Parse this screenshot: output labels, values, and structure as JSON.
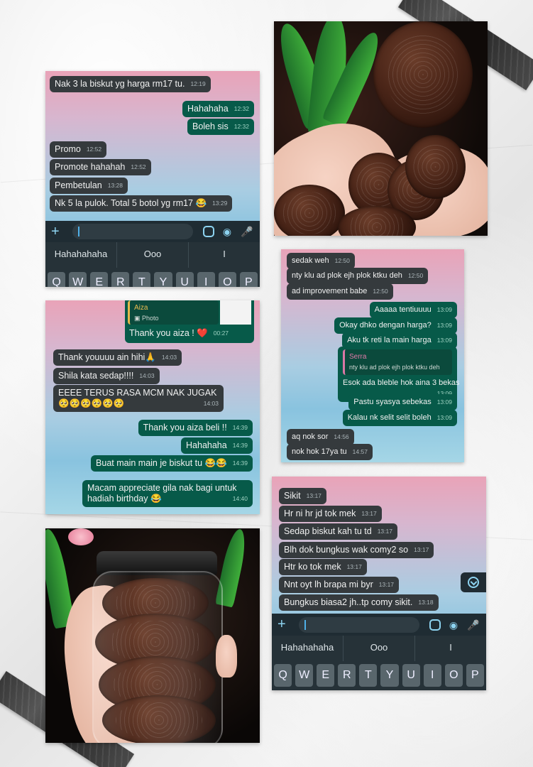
{
  "card1": {
    "messages": [
      {
        "text": "Nak 3 la biskut yg harga rm17 tu.",
        "time": "12:19",
        "dir": "in"
      },
      {
        "text": "Hahahaha",
        "time": "12:32",
        "dir": "out"
      },
      {
        "text": "Boleh sis",
        "time": "12:32",
        "dir": "out"
      },
      {
        "text": "Promo",
        "time": "12:52",
        "dir": "in"
      },
      {
        "text": "Promote hahahah",
        "time": "12:52",
        "dir": "in"
      },
      {
        "text": "Pembetulan",
        "time": "13:28",
        "dir": "in"
      },
      {
        "text": "Nk 5 la pulok. Total 5 botol yg rm17 😂",
        "time": "13:29",
        "dir": "in"
      }
    ],
    "suggestions": [
      "Hahahahaha",
      "Ooo",
      "I"
    ],
    "keys": [
      "Q",
      "W",
      "E",
      "R",
      "T",
      "Y",
      "U",
      "I",
      "O",
      "P"
    ]
  },
  "card2": {
    "reply_name": "Aiza",
    "reply_type": "Photo",
    "messages": [
      {
        "text": "Thank you aiza ! ❤️",
        "time": "00:27",
        "dir": "out"
      },
      {
        "text": "Thank youuuu ain hihi🙏",
        "time": "14:03",
        "dir": "in"
      },
      {
        "text": "Shila kata sedap!!!!",
        "time": "14:03",
        "dir": "in"
      },
      {
        "text": "EEEE TERUS RASA MCM NAK JUGAK🥺🥺🥺🥺🥺🥺",
        "time": "14:03",
        "dir": "in"
      },
      {
        "text": "Thank you aiza beli !!",
        "time": "14:39",
        "dir": "out"
      },
      {
        "text": "Hahahaha",
        "time": "14:39",
        "dir": "out"
      },
      {
        "text": "Buat main main je biskut tu 😂😂",
        "time": "14:39",
        "dir": "out"
      },
      {
        "text": "Macam appreciate gila nak bagi untuk hadiah birthday 😂",
        "time": "14:40",
        "dir": "out"
      }
    ]
  },
  "card3": {
    "messages": [
      {
        "text": "sedak weh",
        "time": "12:50",
        "dir": "in"
      },
      {
        "text": "nty klu ad plok ejh plok ktku deh",
        "time": "12:50",
        "dir": "in"
      },
      {
        "text": "ad improvement babe",
        "time": "12:50",
        "dir": "in"
      },
      {
        "text": "Aaaaa tentiuuuu",
        "time": "13:09",
        "dir": "out"
      },
      {
        "text": "Okay dhko dengan harga?",
        "time": "13:09",
        "dir": "out"
      },
      {
        "text": "Aku tk reti la main harga",
        "time": "13:09",
        "dir": "out"
      },
      {
        "text": "Esok ada bleble hok aina 3 bekas",
        "time": "13:09",
        "dir": "out",
        "quote_name": "Serra",
        "quote_text": "nty klu ad plok ejh plok ktku deh"
      },
      {
        "text": "Pastu syasya sebekas",
        "time": "13:09",
        "dir": "out"
      },
      {
        "text": "Kalau nk selit selit boleh",
        "time": "13:09",
        "dir": "out"
      },
      {
        "text": "aq nok sor",
        "time": "14:56",
        "dir": "in"
      },
      {
        "text": "nok hok 17ya tu",
        "time": "14:57",
        "dir": "in"
      }
    ]
  },
  "card4": {
    "messages": [
      {
        "text": "Sikit",
        "time": "13:17",
        "dir": "in"
      },
      {
        "text": "Hr ni hr jd tok mek",
        "time": "13:17",
        "dir": "in"
      },
      {
        "text": "Sedap biskut kah tu td",
        "time": "13:17",
        "dir": "in"
      },
      {
        "text": "Blh dok bungkus wak comy2 so",
        "time": "13:17",
        "dir": "in"
      },
      {
        "text": "Htr ko tok mek",
        "time": "13:17",
        "dir": "in"
      },
      {
        "text": "Nnt oyt lh brapa mi byr",
        "time": "13:17",
        "dir": "in"
      },
      {
        "text": "Bungkus biasa2 jh..tp comy sikit.",
        "time": "13:18",
        "dir": "in"
      }
    ],
    "suggestions": [
      "Hahahahaha",
      "Ooo",
      "I"
    ],
    "keys": [
      "Q",
      "W",
      "E",
      "R",
      "T",
      "Y",
      "U",
      "I",
      "O",
      "P"
    ]
  }
}
